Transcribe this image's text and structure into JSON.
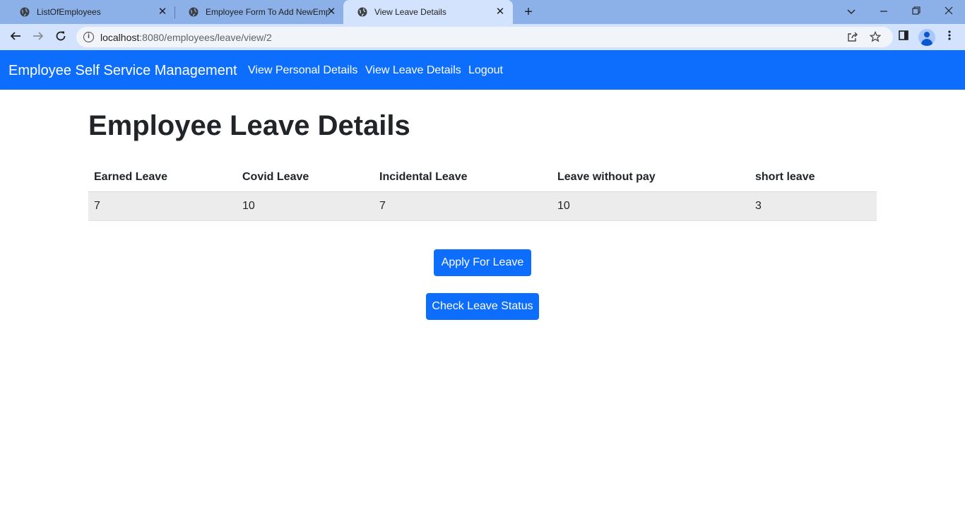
{
  "browser": {
    "tabs": [
      {
        "title": "ListOfEmployees"
      },
      {
        "title": "Employee Form To Add NewEmp"
      },
      {
        "title": "View Leave Details"
      }
    ],
    "url_host": "localhost",
    "url_path": ":8080/employees/leave/view/2"
  },
  "navbar": {
    "brand": "Employee Self Service Management",
    "links": [
      {
        "label": "View Personal Details"
      },
      {
        "label": "View Leave Details"
      },
      {
        "label": "Logout"
      }
    ],
    "color": "#0d6efd"
  },
  "page": {
    "title": "Employee Leave Details"
  },
  "leave_table": {
    "headers": [
      "Earned Leave",
      "Covid Leave",
      "Incidental Leave",
      "Leave without pay",
      "short leave"
    ],
    "rows": [
      [
        "7",
        "10",
        "7",
        "10",
        "3"
      ]
    ]
  },
  "actions": {
    "apply_label": "Apply For Leave",
    "status_label": "Check Leave Status"
  },
  "icons": [
    "globe-icon",
    "close-icon",
    "plus-icon",
    "chevron-down-icon",
    "minimize-icon",
    "restore-icon",
    "back-icon",
    "forward-icon",
    "reload-icon",
    "info-icon",
    "share-icon",
    "star-icon",
    "sidepanel-icon",
    "profile-icon",
    "menu-icon"
  ]
}
